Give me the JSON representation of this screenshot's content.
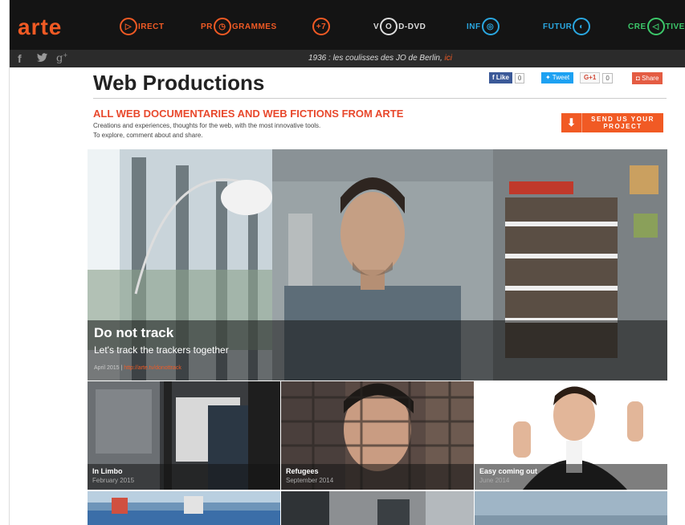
{
  "nav": {
    "logo": "arte",
    "items": [
      {
        "pre": "",
        "icon": "▷",
        "post": "IRECT",
        "color": "#f15a24"
      },
      {
        "pre": "PR",
        "icon": "◷",
        "post": "GRAMMES",
        "color": "#f15a24"
      },
      {
        "pre": "",
        "icon": "+7",
        "post": "",
        "color": "#f15a24"
      },
      {
        "pre": "V",
        "icon": "O",
        "post": "D-DVD",
        "color": "#dddddd"
      },
      {
        "pre": "INF",
        "icon": "◎",
        "post": "",
        "color": "#2aa7e0"
      },
      {
        "pre": "FUTUR",
        "icon": "◐",
        "post": "",
        "color": "#2aa7e0"
      },
      {
        "pre": "CRE",
        "icon": "◁",
        "post": "TIVE",
        "color": "#3cc86a"
      }
    ]
  },
  "social": {
    "ticker_text": "1936 : les coulisses des JO de Berlin, ",
    "ticker_link": "ici"
  },
  "header": {
    "title": "Web Productions",
    "fb_label": "Like",
    "fb_count": "0",
    "tw_label": "Tweet",
    "gp_label": "G+1",
    "gp_count": "0",
    "share_label": "Share",
    "subhead": "ALL WEB DOCUMENTARIES AND WEB FICTIONS FROM ARTE",
    "desc_line1": "Creations and experiences, thoughts for the web, with the most innovative tools.",
    "desc_line2": "To explore, comment about and share.",
    "send_label_1": "SEND US YOUR",
    "send_label_2": "PROJECT"
  },
  "hero": {
    "title": "Do not track",
    "subtitle": "Let's track the trackers together",
    "date": "April 2015 | ",
    "link": "http://arte.tv/donottrack"
  },
  "thumbs": [
    {
      "title": "In Limbo",
      "date": "February 2015"
    },
    {
      "title": "Refugees",
      "date": "September 2014"
    },
    {
      "title": "Easy coming out",
      "date": "June 2014"
    }
  ],
  "colors": {
    "accent": "#f15a24",
    "navbg": "#141414"
  }
}
